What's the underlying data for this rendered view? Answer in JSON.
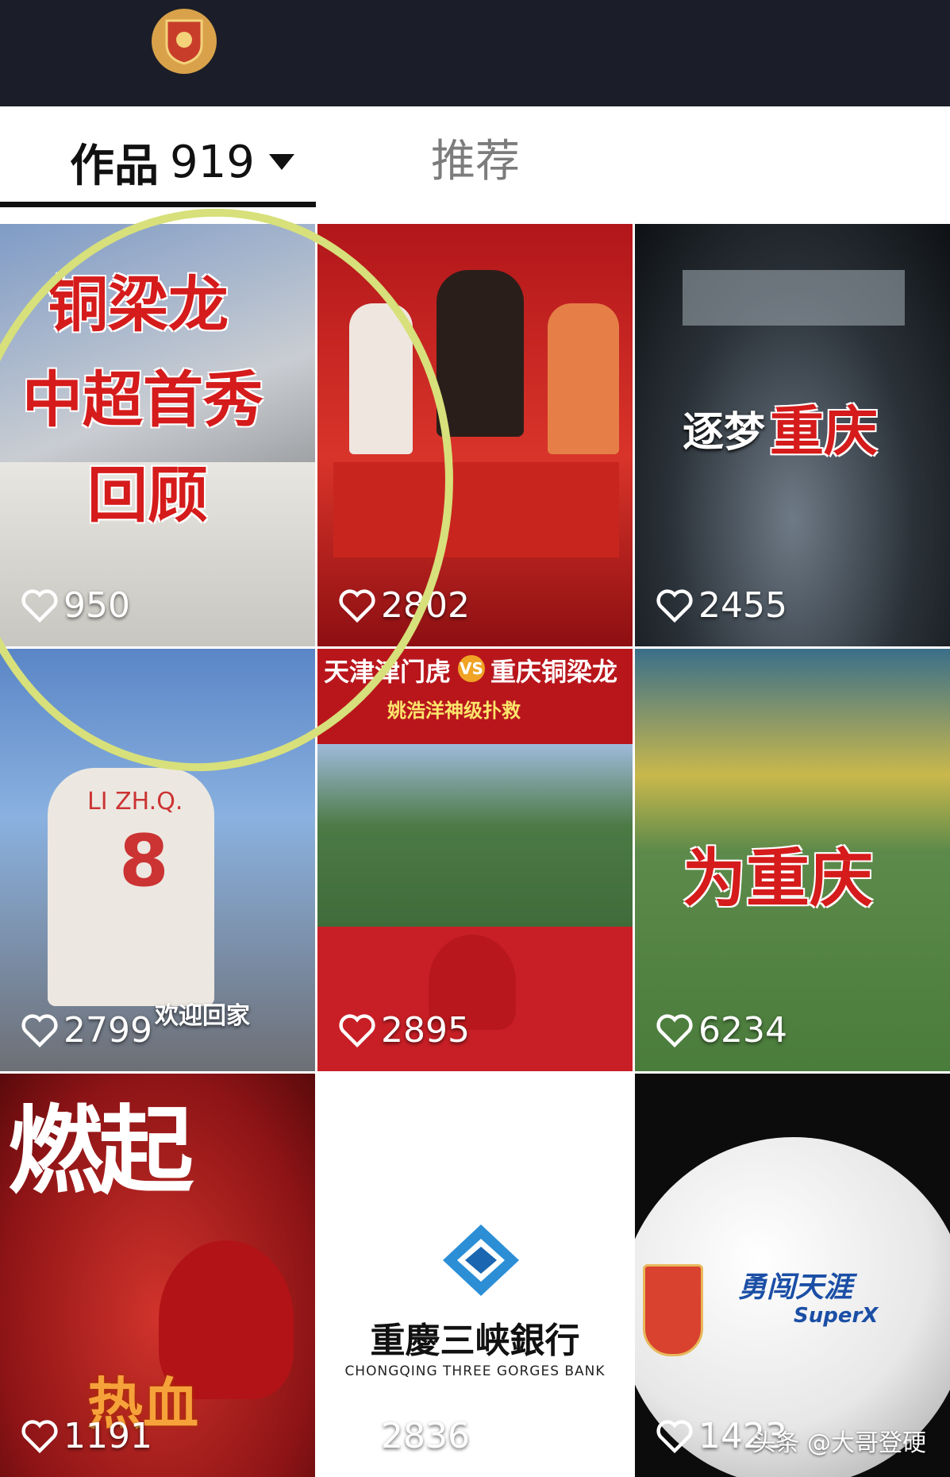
{
  "profile": {
    "logo_icon": "club-crest-icon"
  },
  "tabs": {
    "works_label": "作品",
    "works_count": "919",
    "recommend_label": "推荐"
  },
  "grid": [
    {
      "title_lines": [
        "铜梁龙",
        "中超首秀",
        "回顾"
      ],
      "likes": "950"
    },
    {
      "title": "",
      "likes": "2802"
    },
    {
      "title_white": "逐梦",
      "title_red": "重庆",
      "likes": "2455"
    },
    {
      "subtitle": "欢迎回家",
      "jersey_name": "LI ZH.Q.",
      "jersey_number": "8",
      "likes": "2799"
    },
    {
      "title": "天津津门虎",
      "vs": "VS",
      "opponent": "重庆铜梁龙",
      "subtitle": "姚浩洋神级扑救",
      "likes": "2895"
    },
    {
      "title": "为重庆",
      "likes": "6234"
    },
    {
      "title_top": "燃起",
      "title_bottom": "热血",
      "likes": "1191"
    },
    {
      "bank_name": "重慶三峡銀行",
      "bank_en": "CHONGQING THREE GORGES BANK",
      "likes": "2836"
    },
    {
      "ball_text": "勇闯天涯",
      "ball_brand": "SuperX",
      "likes": "1423"
    }
  ],
  "watermark": "头条 @大哥登硬",
  "colors": {
    "topbar": "#1b1e28",
    "accent_red": "#d51b1b",
    "annotation": "#d7e07a"
  }
}
